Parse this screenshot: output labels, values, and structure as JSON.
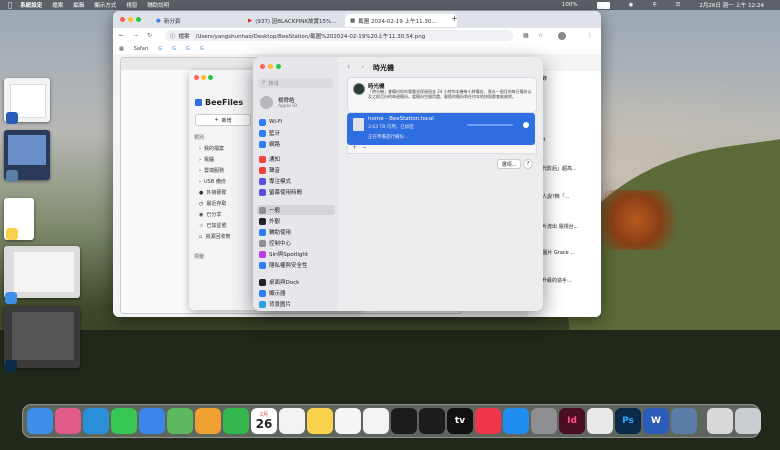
{
  "menubar": {
    "app": "系統設定",
    "items": [
      "檔案",
      "編輯",
      "顯示方式",
      "視窗",
      "輔助說明"
    ],
    "battery": "100%",
    "datetime": "2月26日 週一 上午 12:24"
  },
  "chrome": {
    "tabs": [
      {
        "label": "新分頁"
      },
      {
        "label": "(937) 因BLACKPINK故實15%..."
      },
      {
        "label": "截圖 2024-02-19 上午11.30..."
      }
    ],
    "omnibox_label": "檔案",
    "url": "/Users/yangshunhao/Desktop/BeeStation/截圖%202024-02-19%20上午11.30.54.png",
    "bookmarks": [
      "Safari",
      "G",
      "G",
      "G",
      "G"
    ],
    "right_column": [
      "雅記錄",
      "U.net",
      "全生代影后」超高...",
      "內行人說?飾「...",
      "圖影片流出 電視台...",
      "DIA 圖片 Grace ...",
      "播入升級的造手..."
    ]
  },
  "beefiles": {
    "title": "BeeFiles",
    "new_button": "新增",
    "section_title": "類別",
    "items": [
      "我的檔案",
      "電腦",
      "雲端服務",
      "USB 備份",
      "外接硬碟",
      "最近存取",
      "已分享",
      "已加星號",
      "資源回收筒"
    ],
    "tags_title": "標籤"
  },
  "settings": {
    "search_placeholder": "搜尋",
    "user_name": "楊舜皓",
    "user_sub": "Apple ID",
    "items": [
      {
        "label": "Wi-Fi",
        "color": "#2f7df6"
      },
      {
        "label": "藍牙",
        "color": "#2f7df6"
      },
      {
        "label": "網路",
        "color": "#2f7df6"
      },
      {
        "label": "通知",
        "color": "#f0433a"
      },
      {
        "label": "聲音",
        "color": "#f0433a"
      },
      {
        "label": "專注模式",
        "color": "#5b4fe0"
      },
      {
        "label": "螢幕使用時間",
        "color": "#5b4fe0"
      },
      {
        "label": "一般",
        "color": "#8e8e93"
      },
      {
        "label": "外觀",
        "color": "#222222"
      },
      {
        "label": "輔助使用",
        "color": "#2f7df6"
      },
      {
        "label": "控制中心",
        "color": "#8e8e93"
      },
      {
        "label": "Siri與Spotlight",
        "color": "#c13ce0"
      },
      {
        "label": "隱私權與安全性",
        "color": "#2f7df6"
      },
      {
        "label": "桌面與Dock",
        "color": "#222222"
      },
      {
        "label": "顯示器",
        "color": "#2f7df6"
      },
      {
        "label": "背景圖片",
        "color": "#29a3e0"
      }
    ],
    "selected_index": 7,
    "page_title": "時光機",
    "tm_title": "時光機",
    "tm_desc": "「時光機」會備份你的電腦並保留過去 24 小時的本機每小時備份，過去一個月的每日備份以及之前月份的每週備份。當備份空間用盡，最舊的備份和任何本地快照都會被刪除。",
    "backup_name": "home - BeeStation.local",
    "backup_detail": "3.63 TB 可用，已加密",
    "backup_status": "正在準備進行備份...",
    "options_button": "選項...",
    "help_button": "?"
  },
  "dock": {
    "apps": [
      {
        "name": "finder",
        "color": "#3d8fe8"
      },
      {
        "name": "launchpad",
        "color": "#e05a8a"
      },
      {
        "name": "safari",
        "color": "#2a8fd8"
      },
      {
        "name": "messages",
        "color": "#37c553"
      },
      {
        "name": "mail",
        "color": "#3a86e8"
      },
      {
        "name": "maps",
        "color": "#5cb85c"
      },
      {
        "name": "photos",
        "color": "#f0a030"
      },
      {
        "name": "facetime",
        "color": "#34b84e"
      },
      {
        "name": "calendar",
        "color": "#ffffff"
      },
      {
        "name": "reminders",
        "color": "#f2f2f2"
      },
      {
        "name": "notes",
        "color": "#f7d24a"
      },
      {
        "name": "freeform",
        "color": "#f5f5f5"
      },
      {
        "name": "chrome",
        "color": "#f4f4f4"
      },
      {
        "name": "link",
        "color": "#1c1c1c"
      },
      {
        "name": "iphone-mirroring",
        "color": "#1c1c1c"
      },
      {
        "name": "tv",
        "color": "#111111"
      },
      {
        "name": "music",
        "color": "#f0354c"
      },
      {
        "name": "app-store",
        "color": "#1f8ef0"
      },
      {
        "name": "system-settings",
        "color": "#8e8e93"
      },
      {
        "name": "indesign",
        "color": "#4b0f24"
      },
      {
        "name": "preview",
        "color": "#e8e8e8"
      },
      {
        "name": "photoshop",
        "color": "#0c2a4a"
      },
      {
        "name": "word",
        "color": "#2b5cb8"
      },
      {
        "name": "screen",
        "color": "#5a7ea8"
      },
      {
        "name": "finder-window",
        "color": "#d8d8d8"
      },
      {
        "name": "trash",
        "color": "#c9ccd0"
      }
    ],
    "calendar_month": "2月",
    "calendar_day": "26",
    "tv_label": "tv",
    "indesign_label": "Id",
    "photoshop_label": "Ps",
    "word_label": "W"
  }
}
